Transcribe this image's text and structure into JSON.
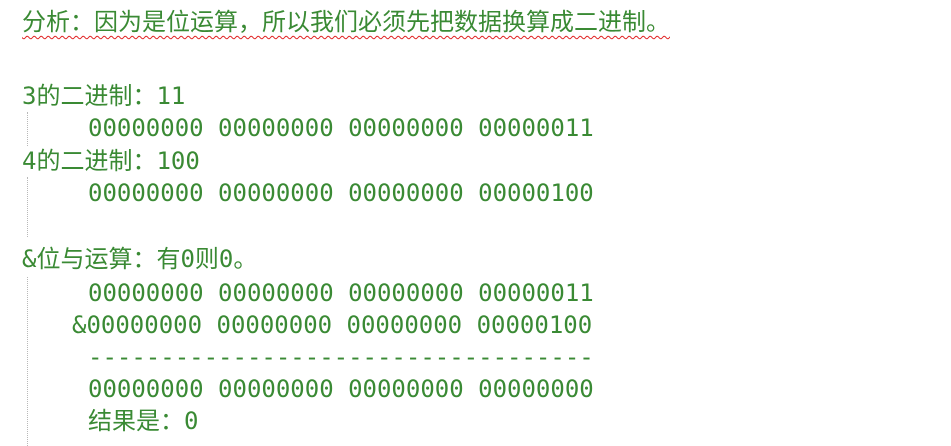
{
  "editor": {
    "heading": "分析：因为是位运算，所以我们必须先把数据换算成二进制。",
    "line_3_label": "3的二进制：11",
    "line_3_binary": "00000000 00000000 00000000 00000011",
    "line_4_label": "4的二进制：100",
    "line_4_binary": "00000000 00000000 00000000 00000100",
    "and_label": "&位与运算：有0则0。",
    "and_operand1": "00000000 00000000 00000000 00000011",
    "and_operand2": "&00000000 00000000 00000000 00000100",
    "and_divider": "-----------------------------------",
    "and_result_binary": "00000000 00000000 00000000 00000000",
    "and_result_text": "结果是：0"
  },
  "colors": {
    "text": "#3a8a34",
    "spell_underline": "#e02020",
    "indent_guide": "#b8b8b8",
    "background": "#ffffff"
  }
}
